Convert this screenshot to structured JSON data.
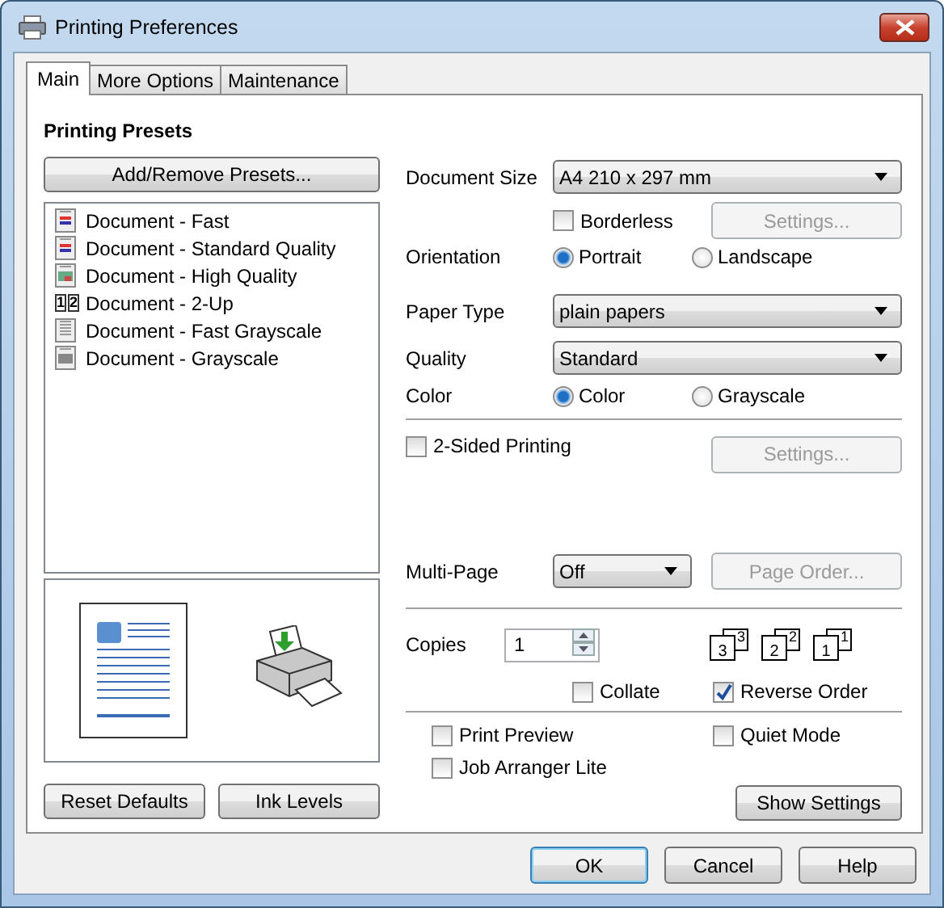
{
  "window": {
    "title": "Printing Preferences"
  },
  "tabs": [
    {
      "label": "Main",
      "selected": true
    },
    {
      "label": "More Options",
      "selected": false
    },
    {
      "label": "Maintenance",
      "selected": false
    }
  ],
  "presets": {
    "title": "Printing Presets",
    "add_button": "Add/Remove Presets...",
    "items": [
      {
        "label": "Document - Fast",
        "kind": "document"
      },
      {
        "label": "Document - Standard Quality",
        "kind": "document"
      },
      {
        "label": "Document - High Quality",
        "kind": "photo"
      },
      {
        "label": "Document - 2-Up",
        "kind": "two-up",
        "icon_labels": [
          "1",
          "2"
        ]
      },
      {
        "label": "Document - Fast Grayscale",
        "kind": "gray"
      },
      {
        "label": "Document - Grayscale",
        "kind": "photo-gray"
      }
    ]
  },
  "left_buttons": [
    {
      "label": "Reset Defaults"
    },
    {
      "label": "Ink Levels"
    }
  ],
  "document_size": {
    "label": "Document Size",
    "value": "A4 210 x 297 mm"
  },
  "borderless": {
    "label": "Borderless",
    "checked": false
  },
  "borderless_settings": {
    "label": "Settings...",
    "disabled": true
  },
  "orientation": {
    "label": "Orientation",
    "options": [
      {
        "label": "Portrait",
        "selected": true
      },
      {
        "label": "Landscape",
        "selected": false
      }
    ]
  },
  "paper_type": {
    "label": "Paper Type",
    "value": "plain papers"
  },
  "quality": {
    "label": "Quality",
    "value": "Standard"
  },
  "color": {
    "label": "Color",
    "options": [
      {
        "label": "Color",
        "selected": true
      },
      {
        "label": "Grayscale",
        "selected": false
      }
    ]
  },
  "two_sided": {
    "label": "2-Sided Printing",
    "checked": false
  },
  "two_sided_settings": {
    "label": "Settings...",
    "disabled": true
  },
  "multi_page": {
    "label": "Multi-Page",
    "value": "Off"
  },
  "page_order": {
    "label": "Page Order...",
    "disabled": true
  },
  "copies": {
    "label": "Copies",
    "value": "1"
  },
  "page_stacks": [
    {
      "front": "3",
      "back": "3"
    },
    {
      "front": "2",
      "back": "2"
    },
    {
      "front": "1",
      "back": "1"
    }
  ],
  "collate": {
    "label": "Collate",
    "checked": false
  },
  "reverse_order": {
    "label": "Reverse Order",
    "checked": true
  },
  "options": [
    {
      "label": "Print Preview",
      "checked": false
    },
    {
      "label": "Quiet Mode",
      "checked": false
    },
    {
      "label": "Job Arranger Lite",
      "checked": false
    }
  ],
  "show_settings": {
    "label": "Show Settings"
  },
  "buttons": [
    {
      "label": "OK",
      "default": true
    },
    {
      "label": "Cancel",
      "default": false
    },
    {
      "label": "Help",
      "default": false
    }
  ]
}
